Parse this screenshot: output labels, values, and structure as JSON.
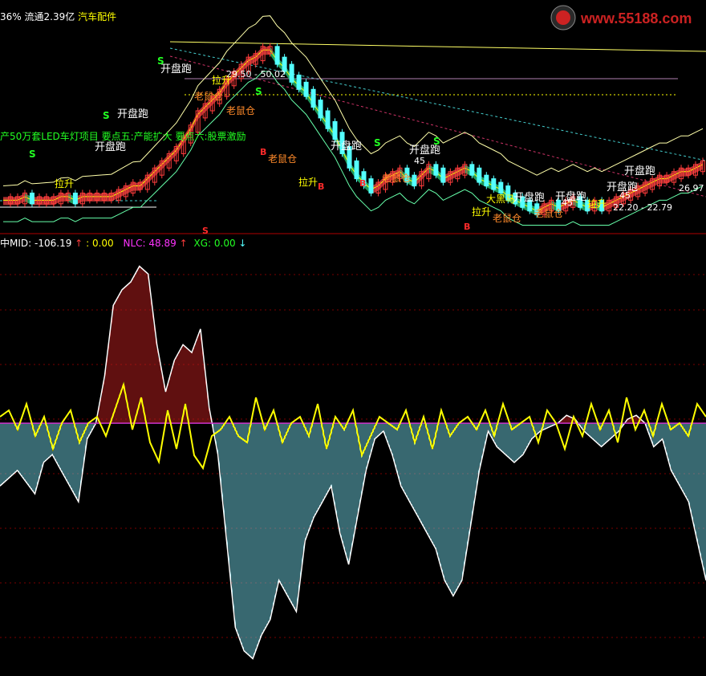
{
  "header": {
    "pct": "36%",
    "float_label": "流通2.39亿",
    "sector": "汽车配件"
  },
  "watermark": {
    "text": "www.55188.com"
  },
  "indicator_header": {
    "mid_label": "中MID:",
    "mid_value": "-106.19",
    "blank_label": ":",
    "blank_value": "0.00",
    "nlc_label": "NLC:",
    "nlc_value": "48.89",
    "xg_label": "XG:",
    "xg_value": "0.00"
  },
  "colors": {
    "up": "#ff3c3c",
    "down": "#54ffff",
    "ma": "#ffff00",
    "ribbon_up": "#b03030",
    "ribbon_down": "#1f9a5a",
    "text_green": "#22ff22",
    "text_magenta": "#ff33ff"
  },
  "annotations": {
    "ticker_note": "产50万套LED车灯项目 要点五:产能扩大 要点六:股票激励",
    "price_labels": [
      "29.50 - 50.02",
      "22.20 - 22.79",
      "26.97"
    ],
    "kai_pan_pao": "开盘跑",
    "lao_shu_cang": "老鼠仓",
    "la_sheng": "拉升",
    "buy": "B",
    "sell": "S",
    "da_hei_ma": "大黑马",
    "value_45": "45"
  },
  "chart_data": {
    "type": "line",
    "title": "",
    "price_series": {
      "name": "",
      "values": [
        8,
        8,
        8,
        9,
        8,
        8,
        8,
        8,
        9,
        9,
        8,
        9,
        9,
        9,
        9,
        9,
        10,
        11,
        12,
        12,
        14,
        16,
        18,
        20,
        22,
        25,
        28,
        32,
        34,
        36,
        38,
        41,
        43,
        45,
        47,
        48,
        50,
        50,
        47,
        45,
        42,
        40,
        38,
        35,
        32,
        29,
        26,
        22,
        18,
        15,
        13,
        11,
        12,
        14,
        15,
        16,
        14,
        13,
        15,
        17,
        16,
        14,
        15,
        16,
        17,
        16,
        14,
        13,
        12,
        11,
        9,
        8,
        7,
        6,
        5,
        6,
        7,
        6,
        7,
        8,
        7,
        6,
        7,
        6,
        7,
        8,
        9,
        10,
        11,
        12,
        13,
        14,
        14,
        15,
        16,
        16,
        17,
        18
      ],
      "ylim": [
        0,
        55
      ]
    },
    "oscillator": {
      "name": "MID",
      "values": [
        -80,
        -70,
        -60,
        -75,
        -90,
        -50,
        -40,
        -60,
        -80,
        -100,
        -20,
        0,
        60,
        150,
        170,
        180,
        200,
        190,
        100,
        40,
        80,
        100,
        90,
        120,
        20,
        -40,
        -150,
        -260,
        -290,
        -300,
        -270,
        -250,
        -200,
        -220,
        -240,
        -150,
        -120,
        -100,
        -80,
        -140,
        -180,
        -120,
        -60,
        -20,
        -10,
        -40,
        -80,
        -100,
        -120,
        -140,
        -160,
        -200,
        -220,
        -200,
        -130,
        -60,
        -10,
        -30,
        -40,
        -50,
        -40,
        -20,
        -10,
        -5,
        0,
        10,
        5,
        -10,
        -20,
        -30,
        -20,
        -10,
        5,
        10,
        0,
        -30,
        -20,
        -60,
        -80,
        -100,
        -150,
        -200
      ],
      "ylim": [
        -320,
        220
      ]
    },
    "nlc": {
      "name": "NLC",
      "values": [
        10,
        20,
        -10,
        30,
        -20,
        10,
        -40,
        0,
        20,
        -30,
        0,
        10,
        -20,
        20,
        60,
        -10,
        40,
        -30,
        -60,
        20,
        -40,
        30,
        -50,
        -70,
        -20,
        -10,
        10,
        -20,
        -30,
        40,
        -10,
        20,
        -30,
        0,
        10,
        -20,
        30,
        -40,
        10,
        -10,
        20,
        -50,
        -20,
        10,
        0,
        -10,
        20,
        -30,
        10,
        -40,
        20,
        -20,
        0,
        10,
        -10,
        20,
        -20,
        30,
        -10,
        0,
        10,
        -30,
        20,
        0,
        -40,
        10,
        -20,
        30,
        -10,
        20,
        -30,
        40,
        -10,
        20,
        -20,
        30,
        -10,
        0,
        -20,
        30,
        10
      ],
      "ylim": [
        -100,
        100
      ]
    },
    "xlabel": "",
    "ylabel": ""
  }
}
